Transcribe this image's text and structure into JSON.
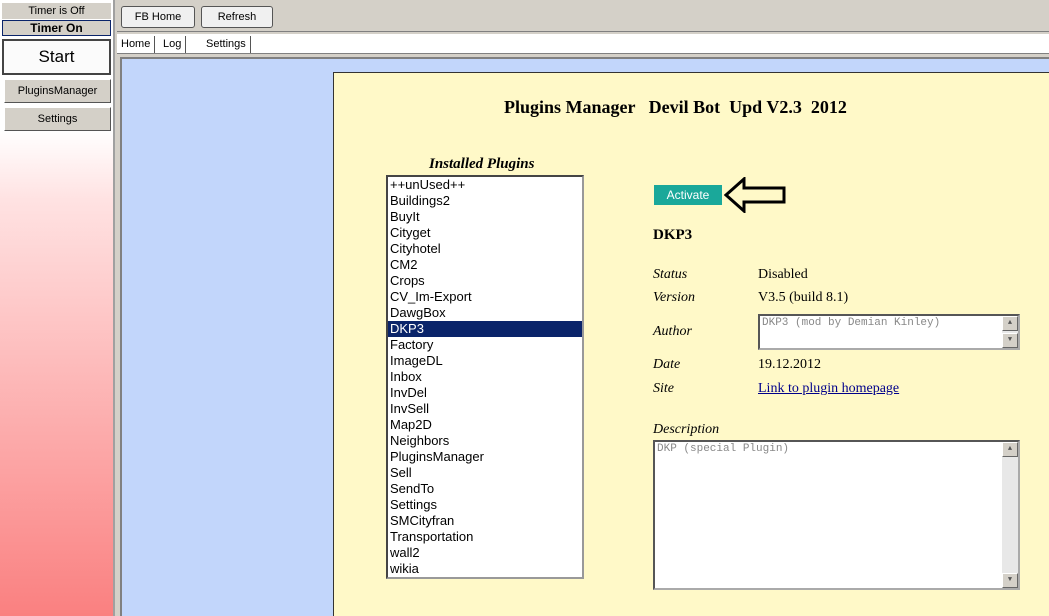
{
  "left_panel": {
    "timer_status": "Timer is Off",
    "timer_toggle": "Timer On",
    "start_label": "Start",
    "buttons": [
      "PluginsManager",
      "Settings"
    ]
  },
  "toolbar": {
    "fb_home": "FB Home",
    "refresh": "Refresh"
  },
  "tabs": [
    "Home",
    "Log",
    "Settings"
  ],
  "plugins_manager": {
    "title": "Plugins Manager   Devil Bot  Upd V2.3  2012",
    "installed_label": "Installed Plugins",
    "plugins": [
      "++unUsed++",
      "Buildings2",
      "BuyIt",
      "Cityget",
      "Cityhotel",
      "CM2",
      "Crops",
      "CV_Im-Export",
      "DawgBox",
      "DKP3",
      "Factory",
      "ImageDL",
      "Inbox",
      "InvDel",
      "InvSell",
      "Map2D",
      "Neighbors",
      "PluginsManager",
      "Sell",
      "SendTo",
      "Settings",
      "SMCityfran",
      "Transportation",
      "wall2",
      "wikia"
    ],
    "selected_plugin": "DKP3",
    "activate_label": "Activate",
    "details": {
      "name": "DKP3",
      "status_label": "Status",
      "status": "Disabled",
      "version_label": "Version",
      "version": "V3.5 (build 8.1)",
      "author_label": "Author",
      "author": "DKP3 (mod by Demian Kinley)",
      "date_label": "Date",
      "date": "19.12.2012",
      "site_label": "Site",
      "site_link": "Link to plugin homepage",
      "description_label": "Description",
      "description": "DKP (special Plugin)"
    }
  }
}
